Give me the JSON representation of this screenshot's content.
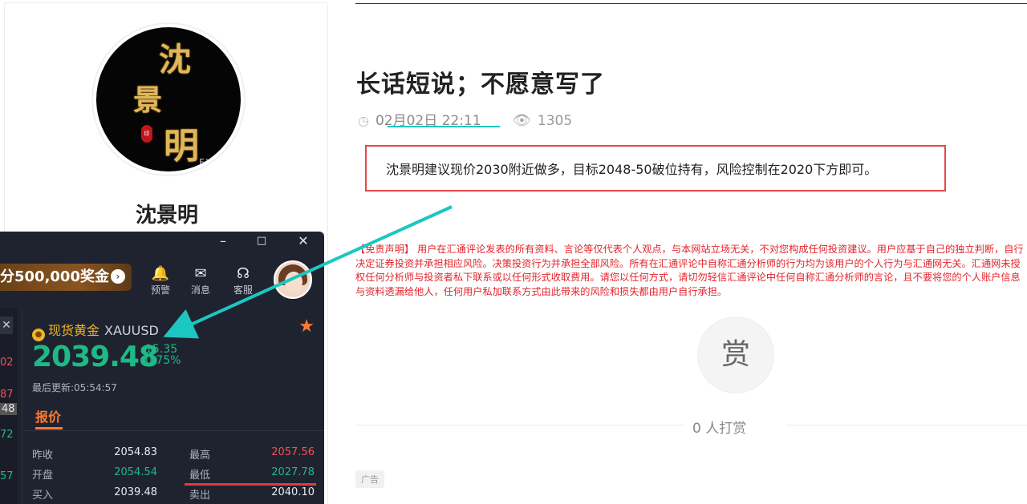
{
  "profile": {
    "name": "沈景明",
    "avatar_calligraphy": [
      "沈",
      "景",
      "明"
    ],
    "avatar_mark": "FX6"
  },
  "quote_window": {
    "controls": {
      "minimize": "–",
      "maximize": "□",
      "close": "✕"
    },
    "promo": {
      "text": "分500,000奖金",
      "arrow": "›"
    },
    "toolbar": [
      {
        "icon": "bell-icon",
        "label": "预警"
      },
      {
        "icon": "mail-icon",
        "label": "消息"
      },
      {
        "icon": "headset-icon",
        "label": "客服"
      }
    ],
    "left_strip": {
      "close": "✕",
      "values": [
        "02",
        "87",
        "48",
        "72",
        "57"
      ]
    },
    "symbol": {
      "name": "现货黄金",
      "code": "XAUUSD",
      "price": "2039.48",
      "change": "-15.35",
      "change_pct": "-0.75%",
      "updated": "最后更新:05:54:57",
      "tab": "报价"
    },
    "quotes": [
      {
        "l1": "昨收",
        "v1": "2054.83",
        "l2": "最高",
        "v2": "2057.56"
      },
      {
        "l1": "开盘",
        "v1": "2054.54",
        "l2": "最低",
        "v2": "2027.78"
      },
      {
        "l1": "买入",
        "v1": "2039.48",
        "l2": "卖出",
        "v2": "2040.10"
      }
    ],
    "colors": {
      "up": "#f0524f",
      "down": "#1fb986",
      "accent": "#ff7a2f"
    }
  },
  "article": {
    "title": "长话短说；不愿意写了",
    "date": "02月02日 22:11",
    "views": "1305",
    "advice": "沈景明建议现价2030附近做多，目标2048-50破位持有，风险控制在2020下方即可。",
    "disclaimer": "【免责声明】 用户在汇通评论发表的所有资料、言论等仅代表个人观点，与本网站立场无关，不对您构成任何投资建议。用户应基于自己的独立判断，自行决定证券投资并承担相应风险。决策投资行为并承担全部风险。所有在汇通评论中自称汇通分析师的行为均为该用户的个人行为与汇通网无关。汇通网未授权任何分析师与投资者私下联系或以任何形式收取费用。请您以任何方式，请切勿轻信汇通评论中任何自称汇通分析师的言论，且不要将您的个人账户信息与资料透漏给他人，任何用户私加联系方式由此带来的风险和损失都由用户自行承担。",
    "reward_button": "赏",
    "reward_count": "0 人打赏",
    "ad_label": "广告"
  }
}
